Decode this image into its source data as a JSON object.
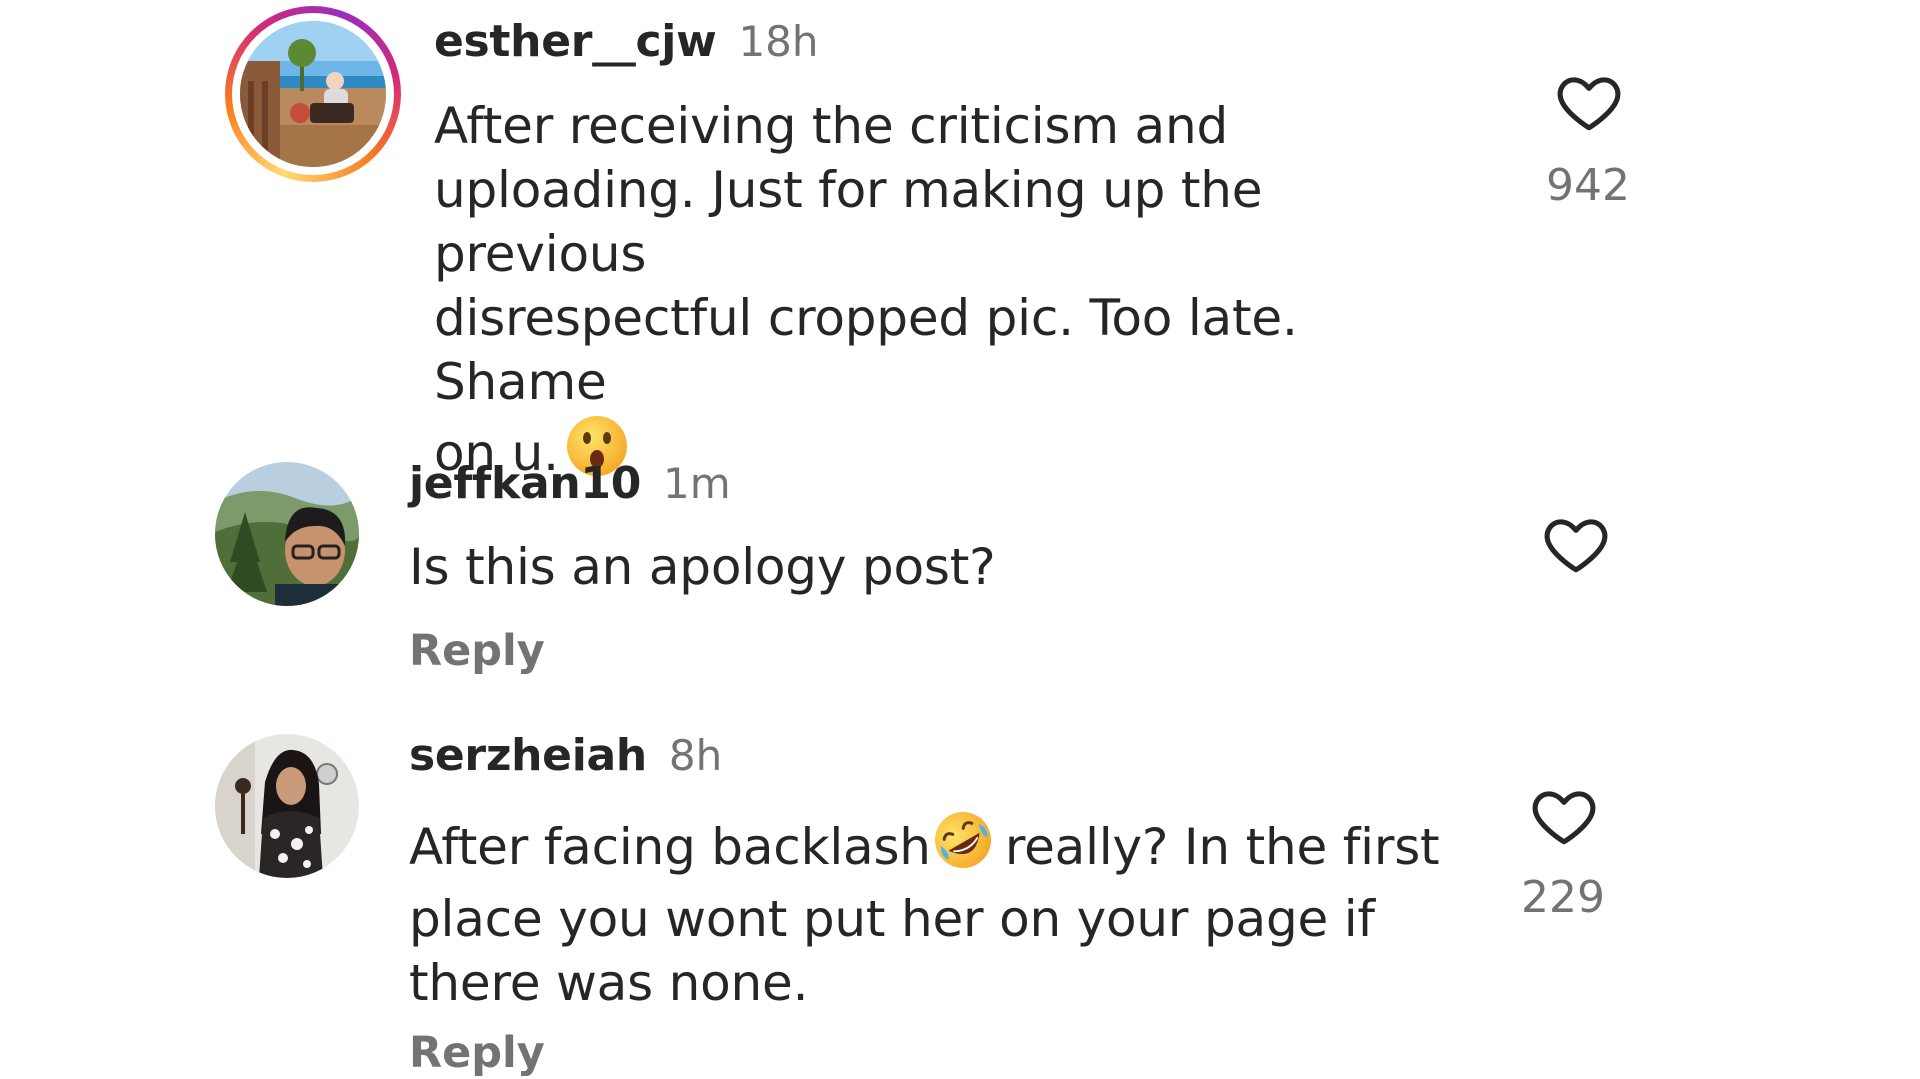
{
  "comments": [
    {
      "username": "esther__cjw",
      "time": "18h",
      "text": "After receiving the criticism and uploading. Just for making up the previous disrespectful cropped pic. Too late. Shame on u.",
      "lines": [
        "After receiving the criticism and",
        "uploading. Just for making up the previous",
        "disrespectful cropped pic. Too late. Shame",
        "on u."
      ],
      "emoji": "astonished-face",
      "likes": "942",
      "has_story_ring": true,
      "reply_label": ""
    },
    {
      "username": "jeffkan10",
      "time": "1m",
      "text": "Is this an apology post?",
      "lines": [
        "Is this an apology post?"
      ],
      "likes": "",
      "has_story_ring": false,
      "reply_label": "Reply"
    },
    {
      "username": "serzheiah",
      "time": "8h",
      "text": "After facing backlash really? In the first place you wont put her on your page if there was none.",
      "lines": [
        "After facing backlash",
        "really? In the first",
        "place you wont put her on your page if",
        "there was none."
      ],
      "emoji": "rolling-on-the-floor-laughing",
      "likes": "229",
      "has_story_ring": false,
      "reply_label": "Reply"
    }
  ],
  "colors": {
    "text": "#262626",
    "secondary": "#737373",
    "background": "#ffffff"
  },
  "icons": [
    "heart-outline-icon"
  ]
}
